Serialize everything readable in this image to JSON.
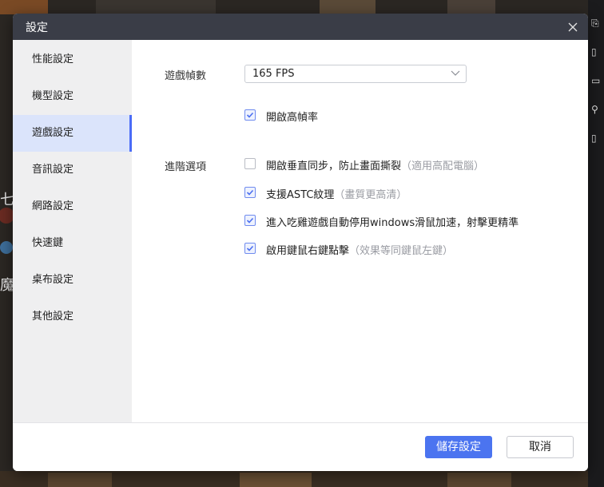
{
  "dialog": {
    "title": "設定",
    "close_icon": "close-icon"
  },
  "sidebar": {
    "items": [
      {
        "label": "性能設定",
        "active": false
      },
      {
        "label": "機型設定",
        "active": false
      },
      {
        "label": "遊戲設定",
        "active": true
      },
      {
        "label": "音訊設定",
        "active": false
      },
      {
        "label": "網路設定",
        "active": false
      },
      {
        "label": "快速鍵",
        "active": false
      },
      {
        "label": "桌布設定",
        "active": false
      },
      {
        "label": "其他設定",
        "active": false
      }
    ]
  },
  "game_settings": {
    "frame_rate": {
      "label": "遊戲幀數",
      "selected": "165 FPS",
      "high_fps": {
        "label": "開啟高幀率",
        "checked": true
      }
    },
    "advanced": {
      "label": "進階選項",
      "options": [
        {
          "label": "開啟垂直同步，防止畫面撕裂",
          "note": "（適用高配電腦）",
          "checked": false
        },
        {
          "label": "支援ASTC紋理",
          "note": "（畫質更高清）",
          "checked": true
        },
        {
          "label": "進入吃雞遊戲自動停用windows滑鼠加速，射擊更精準",
          "note": "",
          "checked": true
        },
        {
          "label": "啟用鍵鼠右鍵點擊",
          "note": "（效果等同鍵鼠左鍵）",
          "checked": true
        }
      ]
    }
  },
  "footer": {
    "save_label": "儲存設定",
    "cancel_label": "取消"
  },
  "background": {
    "visible_text": [
      "七",
      "魔"
    ]
  },
  "colors": {
    "titlebar": "#3a3d47",
    "accent": "#4b74f0",
    "active_nav_bg": "#dbe4fb",
    "sidebar_bg": "#efeff0"
  }
}
